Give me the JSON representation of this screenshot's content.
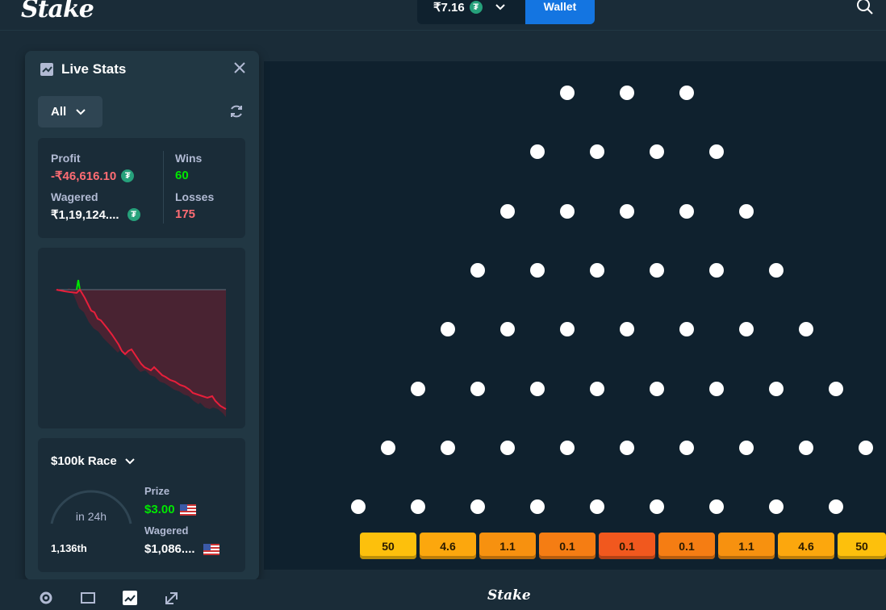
{
  "header": {
    "logo": "Stake",
    "balance": "₹7.16",
    "currency_icon": "tether-icon",
    "wallet_label": "Wallet"
  },
  "panel": {
    "title": "Live Stats",
    "filter": "All",
    "stats": {
      "profit_label": "Profit",
      "profit_value": "-₹46,616.10",
      "wagered_label": "Wagered",
      "wagered_value": "₹1,19,124....",
      "wins_label": "Wins",
      "wins_value": "60",
      "losses_label": "Losses",
      "losses_value": "175"
    },
    "race": {
      "title": "$100k Race",
      "timer": "in 24h",
      "rank": "1,136th",
      "prize_label": "Prize",
      "prize_value": "$3.00",
      "wagered_label": "Wagered",
      "wagered_value": "$1,086...."
    }
  },
  "plinko": {
    "multipliers": [
      "50",
      "4.6",
      "1.1",
      "0.1",
      "0.1",
      "0.1",
      "1.1",
      "4.6",
      "50"
    ]
  },
  "footer": {
    "logo": "Stake"
  },
  "colors": {
    "profit_negative": "#fe6c73",
    "wins": "#00e701",
    "losses": "#fe6c73",
    "accent_blue": "#1475e1"
  }
}
